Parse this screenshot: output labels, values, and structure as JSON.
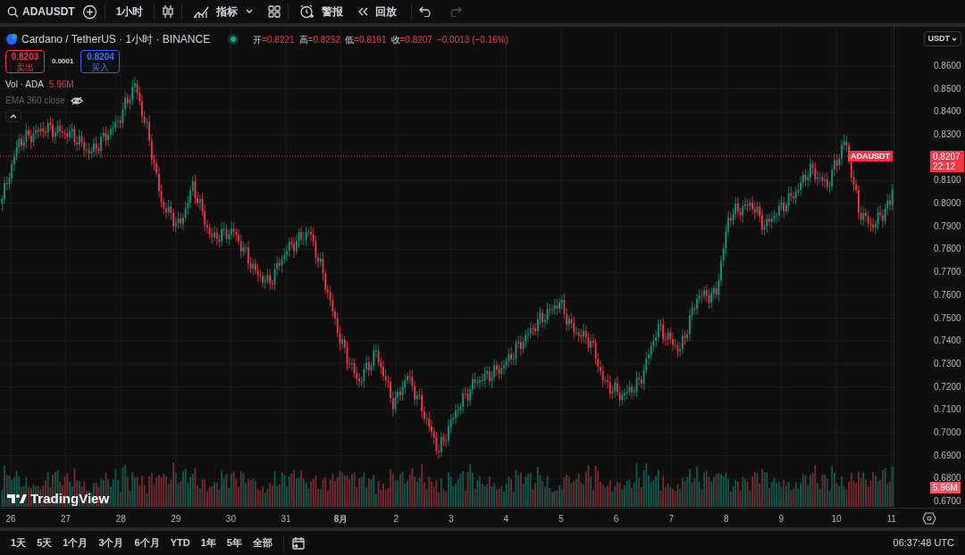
{
  "toolbar": {
    "symbol": "ADAUSDT",
    "interval": "1小时",
    "indicators": "指标",
    "alerts": "警报",
    "replay": "回放"
  },
  "legend": {
    "title": "Cardano / TetherUS · 1小时 · BINANCE",
    "market_open": true,
    "ohlc": [
      {
        "label": "开",
        "value": "=0.8221"
      },
      {
        "label": "高",
        "value": "=0.8252"
      },
      {
        "label": "低",
        "value": "=0.8191"
      },
      {
        "label": "收",
        "value": "=0.8207"
      }
    ],
    "change": "−0.0013 (−0.16%)",
    "sell": {
      "price": "0.8203",
      "label": "卖出"
    },
    "spread": "0.0001",
    "buy": {
      "price": "0.8204",
      "label": "买入"
    },
    "volume": {
      "name": "Vol · ADA",
      "value": "5.96M"
    },
    "ema": {
      "name": "EMA 360 close",
      "hidden": true
    }
  },
  "currency": "USDT",
  "price_axis": {
    "ticks": [
      "0.8600",
      "0.8500",
      "0.8400",
      "0.8300",
      "0.8100",
      "0.8000",
      "0.7900",
      "0.7800",
      "0.7700",
      "0.7600",
      "0.7500",
      "0.7400",
      "0.7300",
      "0.7200",
      "0.7100",
      "0.7000",
      "0.6900",
      "0.6800",
      "0.6700"
    ],
    "last_price": {
      "symbol": "ADAUSDT",
      "price": "0.8207",
      "countdown": "22:12"
    },
    "volume_label": "5.96M"
  },
  "time_axis": {
    "labels": [
      "26",
      "27",
      "28",
      "29",
      "30",
      "31",
      "8月",
      "2",
      "3",
      "4",
      "5",
      "6",
      "7",
      "8",
      "9",
      "10",
      "11"
    ]
  },
  "logo": "TradingView",
  "ranges": [
    "1天",
    "5天",
    "1个月",
    "3个月",
    "6个月",
    "YTD",
    "1年",
    "5年",
    "全部"
  ],
  "clock": "06:37:48 UTC"
}
